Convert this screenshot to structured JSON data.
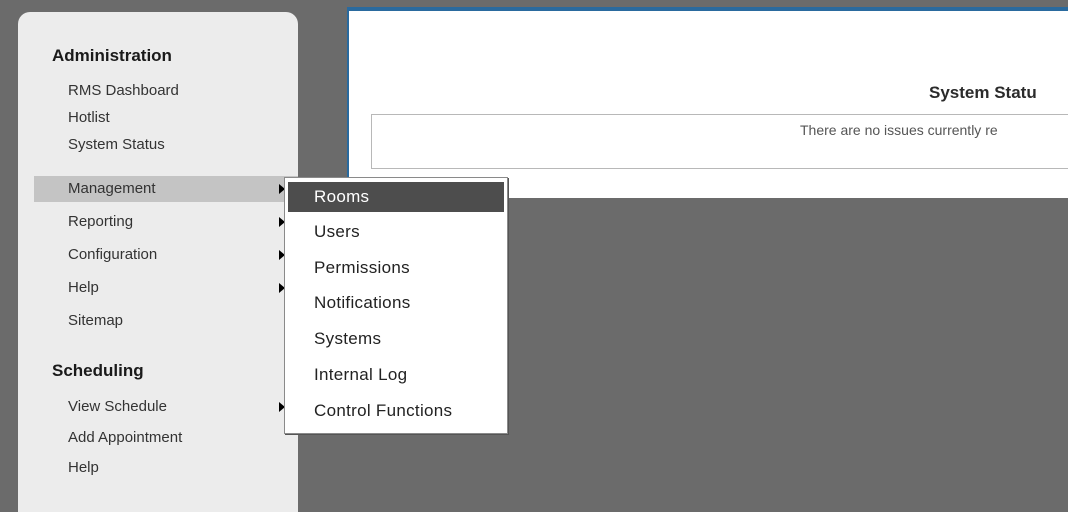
{
  "sidebar": {
    "sections": [
      {
        "title": "Administration",
        "items": [
          {
            "label": "RMS Dashboard",
            "has_submenu": false
          },
          {
            "label": "Hotlist",
            "has_submenu": false
          },
          {
            "label": "System Status",
            "has_submenu": false
          },
          {
            "label": "Management",
            "has_submenu": true,
            "active": true
          },
          {
            "label": "Reporting",
            "has_submenu": true
          },
          {
            "label": "Configuration",
            "has_submenu": true
          },
          {
            "label": "Help",
            "has_submenu": true
          },
          {
            "label": "Sitemap",
            "has_submenu": false
          }
        ]
      },
      {
        "title": "Scheduling",
        "items": [
          {
            "label": "View Schedule",
            "has_submenu": true
          },
          {
            "label": "Add Appointment",
            "has_submenu": false
          },
          {
            "label": "Help",
            "has_submenu": false
          }
        ]
      }
    ]
  },
  "main": {
    "title": "System Statu",
    "message": "There are no issues currently re"
  },
  "submenu": {
    "items": [
      {
        "label": "Rooms",
        "highlighted": true
      },
      {
        "label": "Users"
      },
      {
        "label": "Permissions"
      },
      {
        "label": "Notifications"
      },
      {
        "label": "Systems"
      },
      {
        "label": "Internal Log"
      },
      {
        "label": "Control Functions"
      }
    ]
  },
  "colors": {
    "background": "#6b6b6b",
    "sidebar": "#ececec",
    "active_item": "#c4c4c4",
    "submenu_highlight": "#4d4d4d",
    "panel_border": "#2a6a9e"
  }
}
